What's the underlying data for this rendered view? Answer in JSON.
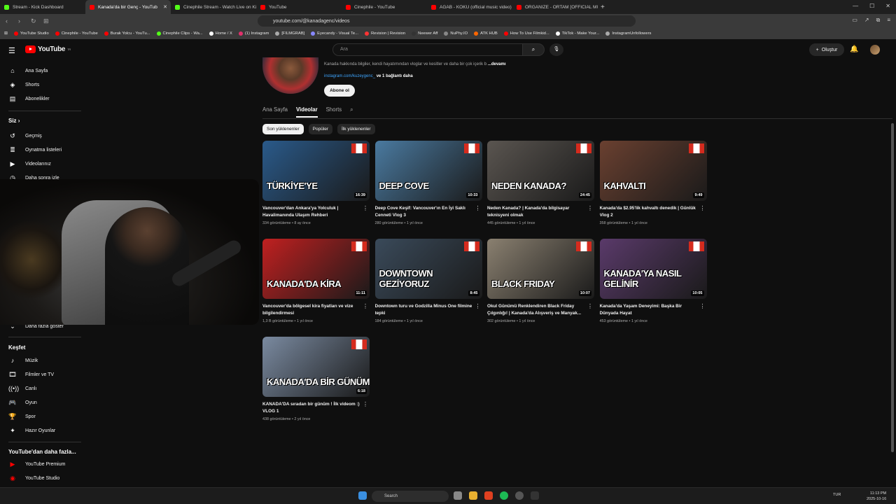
{
  "browser": {
    "tabs": [
      {
        "label": "Stream - Kick Dashboard",
        "color": "#53fc18"
      },
      {
        "label": "Kanada'da bir Genç - YouTub",
        "color": "#ff0000"
      },
      {
        "label": "Cinephile Stream - Watch Live on Kic",
        "color": "#53fc18"
      },
      {
        "label": "YouTube",
        "color": "#ff0000"
      },
      {
        "label": "Cinephile - YouTube",
        "color": "#ff0000"
      },
      {
        "label": "AGAB - KOKU (official music video)",
        "color": "#ff0000"
      },
      {
        "label": "ORGANIZE - ORTAM [OFFICIAL MUSI",
        "color": "#ff0000"
      }
    ],
    "url": "youtube.com/@kanadagenc/videos",
    "bookmarks": [
      {
        "label": "YouTube Studio",
        "color": "#ff0000"
      },
      {
        "label": "Cinephile - YouTube",
        "color": "#ff0000"
      },
      {
        "label": "Burak Yolcu - YouTu...",
        "color": "#ff0000"
      },
      {
        "label": "Cinephile Clips - Wa...",
        "color": "#53fc18"
      },
      {
        "label": "Home / X",
        "color": "#ffffff"
      },
      {
        "label": "(1) Instagram",
        "color": "#e1306c"
      },
      {
        "label": "[FILMGRAB]",
        "color": "#aaaaaa"
      },
      {
        "label": "Eyecandy - Visual Te...",
        "color": "#8888ff"
      },
      {
        "label": "Revision | Revision",
        "color": "#ff3333"
      },
      {
        "label": "Neewer Aff",
        "color": "#333333"
      },
      {
        "label": "NuPhy.IO",
        "color": "#888888"
      },
      {
        "label": "ATK HUB",
        "color": "#ff6600"
      },
      {
        "label": "How To Use Filmkid...",
        "color": "#ff0000"
      },
      {
        "label": "TikTok - Make Your...",
        "color": "#ffffff"
      },
      {
        "label": "InstagramUnfollowers",
        "color": "#aaaaaa"
      }
    ]
  },
  "masthead": {
    "logo": "YouTube",
    "logo_region": "TR",
    "search_placeholder": "Ara",
    "create_label": "Oluştur"
  },
  "sidebar": {
    "top": [
      "Ana Sayfa",
      "Shorts",
      "Abonelikler"
    ],
    "you_title": "Siz",
    "you_items": [
      "Geçmiş",
      "Oynatma listeleri",
      "Videolarınız",
      "Daha sonra izle"
    ],
    "show_more": "Daha fazla göster",
    "explore_title": "Keşfet",
    "explore_items": [
      "Müzik",
      "Filmler ve TV",
      "Canlı",
      "Oyun",
      "Spor",
      "Hazır Oyunlar"
    ],
    "more_title": "YouTube'dan daha fazla...",
    "more_items": [
      "YouTube Premium",
      "YouTube Studio"
    ]
  },
  "channel": {
    "description": "Kanada hakkında bilgiler, kendi hayatımından vloglar ve kesitler ve daha bir çok içerik b",
    "more": "...devamı",
    "link": "instagram.com/kuzeygenc_",
    "link_more": "ve 1 bağlantı daha",
    "subscribe": "Abone ol",
    "tabs": [
      "Ana Sayfa",
      "Videolar",
      "Shorts"
    ],
    "active_tab": "Videolar",
    "chips": [
      "Son yüklenenler",
      "Popüler",
      "İlk yüklenenler"
    ]
  },
  "videos": [
    {
      "title": "Vancouver'dan Ankara'ya Yolculuk | Havalimanında Ulaşım Rehberi",
      "views": "334 görüntüleme",
      "age": "8 ay önce",
      "duration": "16:39",
      "thumb_text": "TÜRKİYE'YE",
      "bg": "#2a5a8a"
    },
    {
      "title": "Deep Cove Keşif: Vancouver'ın En İyi Saklı Cenneti Vlog 3",
      "views": "280 görüntüleme",
      "age": "1 yıl önce",
      "duration": "10:33",
      "thumb_text": "DEEP COVE",
      "bg": "#4a7aa0"
    },
    {
      "title": "Neden Kanada? | Kanada'da bilgisayar teknisyeni olmak",
      "views": "445 görüntüleme",
      "age": "1 yıl önce",
      "duration": "24:45",
      "thumb_text": "NEDEN KANADA?",
      "bg": "#5a5550"
    },
    {
      "title": "Kanada'da $2.95'lik kahvaltı denedik | Günlük Vlog 2",
      "views": "358 görüntüleme",
      "age": "1 yıl önce",
      "duration": "9:49",
      "thumb_text": "KAHVALTI",
      "bg": "#6a4030"
    },
    {
      "title": "Vancouver'da bölgesel kira fiyatları ve vize bilgilendirmesi",
      "views": "1,3 B görüntüleme",
      "age": "1 yıl önce",
      "duration": "11:11",
      "thumb_text": "KANADA'DA KİRA",
      "bg": "#c02020"
    },
    {
      "title": "Downtown turu ve Godzilla Minus One filmine tepki",
      "views": "184 görüntüleme",
      "age": "1 yıl önce",
      "duration": "8:45",
      "thumb_text": "DOWNTOWN GEZİYORUZ",
      "bg": "#3a4a5a"
    },
    {
      "title": "Okul Günümü Renklendiren Black Friday Çılgınlığı! | Kanada'da Alışveriş ve Manyak...",
      "views": "302 görüntüleme",
      "age": "1 yıl önce",
      "duration": "10:07",
      "thumb_text": "BLACK FRIDAY",
      "bg": "#8a8070"
    },
    {
      "title": "Kanada'da Yaşam Deneyimi: Başka Bir Dünyada Hayat",
      "views": "453 görüntüleme",
      "age": "1 yıl önce",
      "duration": "10:05",
      "thumb_text": "KANADA'YA NASIL GELİNİR",
      "bg": "#5a3a6a"
    },
    {
      "title": "KANADA'DA sıradan bir günüm ! İlk videom :) VLOG 1",
      "views": "438 görüntüleme",
      "age": "2 yıl önce",
      "duration": "6:18",
      "thumb_text": "KANADA'DA BİR GÜNÜM",
      "bg": "#7a8aa0"
    }
  ],
  "taskbar": {
    "search": "Search",
    "lang": "TUR",
    "time": "11:13 PM",
    "date": "2025-10-16"
  }
}
